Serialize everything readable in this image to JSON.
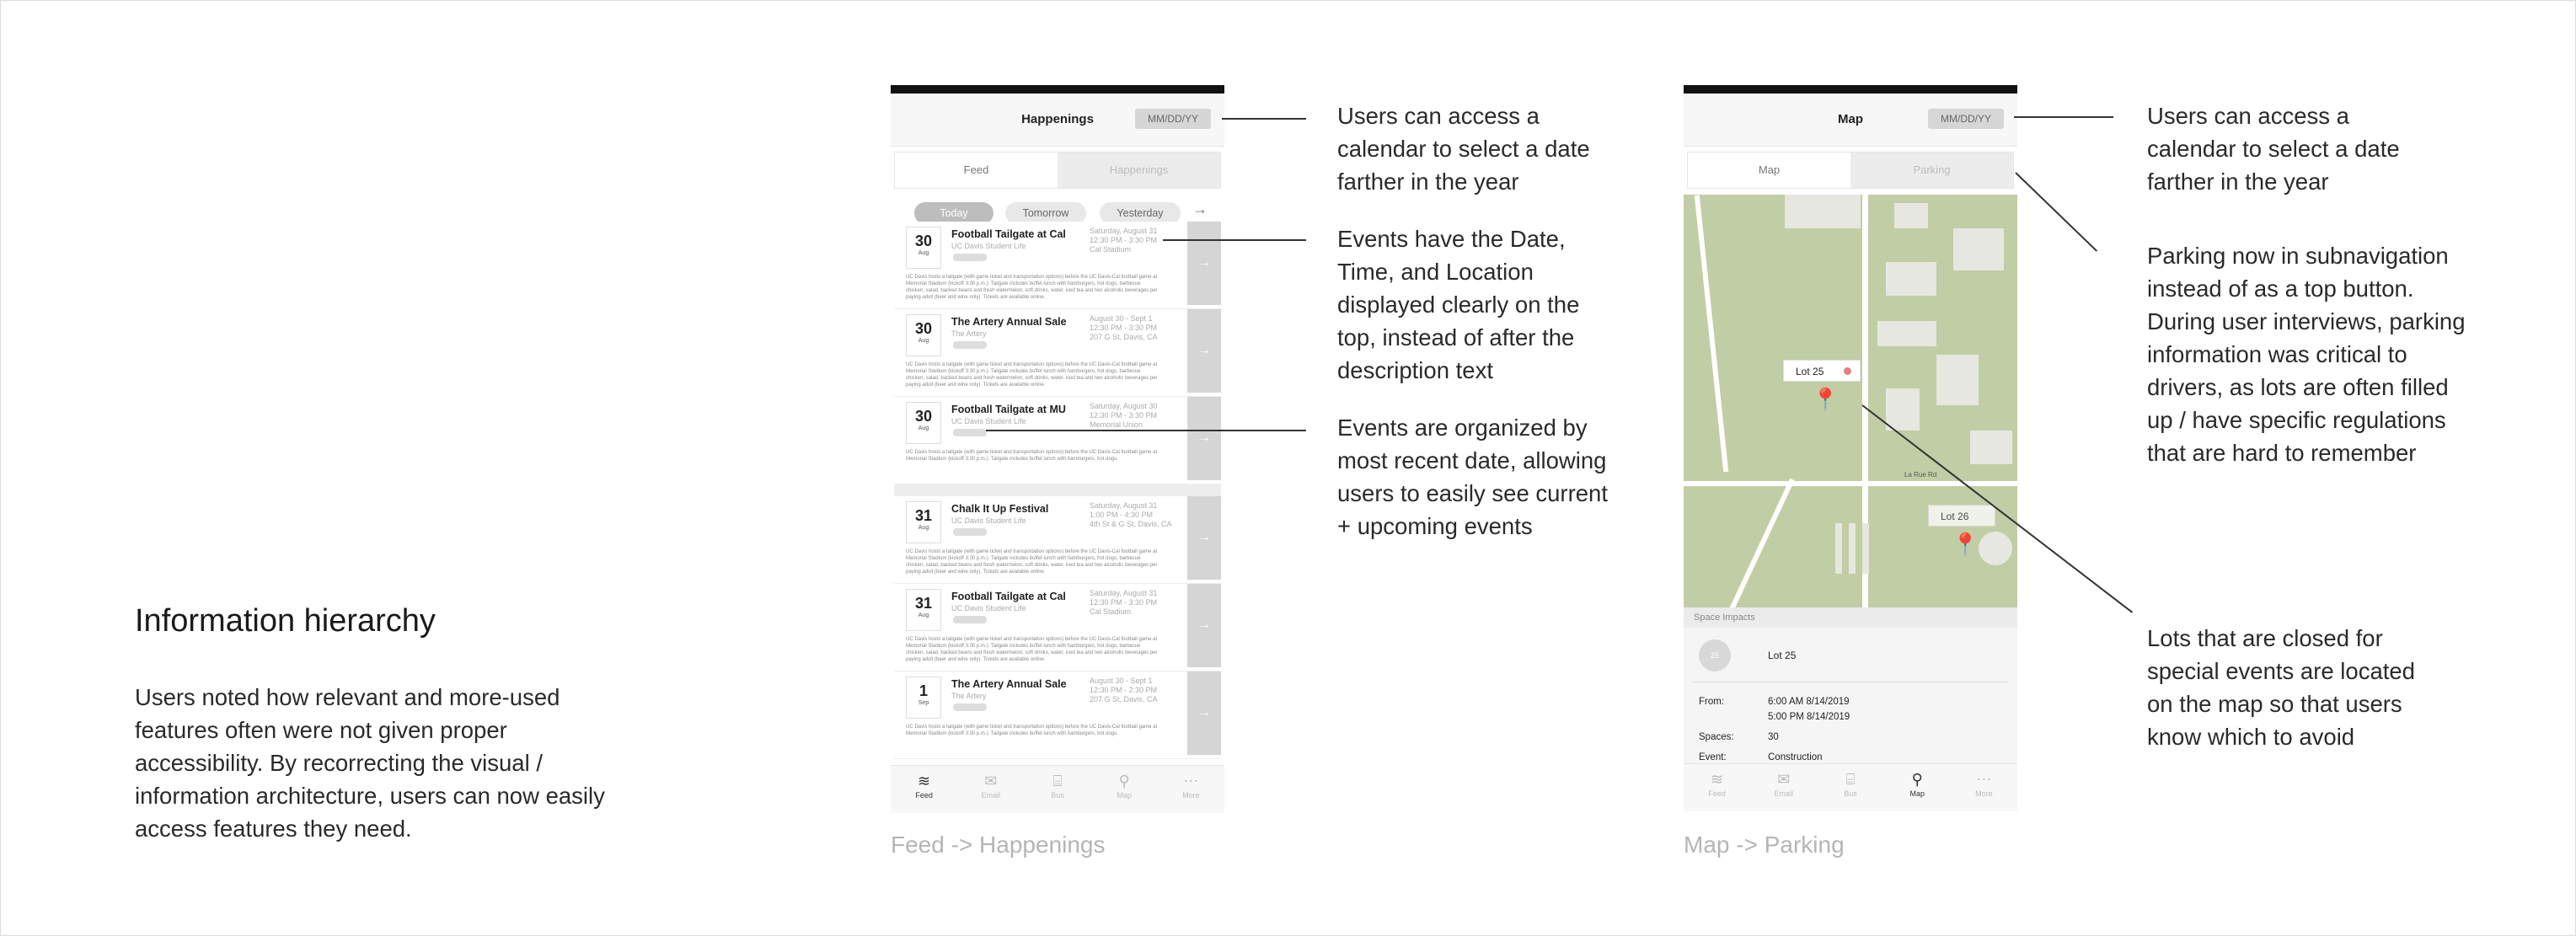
{
  "left": {
    "heading": "Information hierarchy",
    "description": "Users noted how relevant and more-used features often were not given proper accessibility.  By recorrecting the visual / information architecture, users can now easily access features they need."
  },
  "captions": {
    "happenings": "Feed -> Happenings",
    "parking": "Map -> Parking"
  },
  "annotations": {
    "calendar1": "Users can access a calendar to select a date farther in the year",
    "datetime": "Events have the Date, Time, and Location displayed clearly on the top, instead of after the description text",
    "organized": "Events are organized by most recent date, allowing users to easily see current + upcoming events",
    "calendar2": "Users can access a calendar to select a date farther in the year",
    "parking": "Parking now in subnavigation instead of as a top button. During user interviews, parking information was critical to drivers, as lots are often filled up / have specific regulations that are hard to remember",
    "lots": "Lots that are closed for special events are located on the map so that users know which to avoid"
  },
  "happenings_screen": {
    "title": "Happenings",
    "date_button": "MM/DD/YY",
    "seg": [
      "Feed",
      "Happenings"
    ],
    "filters": [
      "Today",
      "Tomorrow",
      "Yesterday"
    ],
    "arrow": "→",
    "events": [
      {
        "day": "30",
        "month": "Aug",
        "title": "Football Tailgate at Cal",
        "org": "UC Davis Student Life",
        "meta": "Saturday, August 31\n12:30 PM - 3:30 PM\nCal Stadium",
        "body": "UC Davis hosts a tailgate (with game ticket and transportation options) before the UC Davis-Cal football game at Memorial Stadium (kickoff 3:30 p.m.). Tailgate includes buffet lunch with hamburgers, hot dogs, barbecue chicken, salad, backed beans and fresh watermelon; soft drinks, water, iced tea and two alcoholic beverages per paying adult (beer and wine only). Tickets are available online."
      },
      {
        "day": "30",
        "month": "Aug",
        "title": "The Artery Annual Sale",
        "org": "The Artery",
        "meta": "August 30 - Sept 1\n12:30 PM - 3:30 PM\n207 G St, Davis, CA",
        "body": "UC Davis hosts a tailgate (with game ticket and transportation options) before the UC Davis-Cal football game at Memorial Stadium (kickoff 3:30 p.m.). Tailgate includes buffet lunch with hamburgers, hot dogs, barbecue chicken, salad, backed beans and fresh watermelon; soft drinks, water, iced tea and two alcoholic beverages per paying adult (beer and wine only). Tickets are available online."
      },
      {
        "day": "30",
        "month": "Aug",
        "title": "Football Tailgate at MU",
        "org": "UC Davis Student Life",
        "meta": "Saturday, August 30\n12:30 PM - 3:30 PM\nMemorial Union",
        "body": "UC Davis hosts a tailgate (with game ticket and transportation options) before the UC Davis-Cal football game at Memorial Stadium (kickoff 3:30 p.m.). Tailgate includes buffet lunch with hamburgers, hot dogs."
      },
      {
        "day": "31",
        "month": "Aug",
        "title": "Chalk It Up Festival",
        "org": "UC Davis Student Life",
        "meta": "Saturday, August 31\n1:00 PM - 4:30 PM\n4th St & G St, Davis, CA",
        "body": "UC Davis hosts a tailgate (with game ticket and transportation options) before the UC Davis-Cal football game at Memorial Stadium (kickoff 3:30 p.m.). Tailgate includes buffet lunch with hamburgers, hot dogs, barbecue chicken, salad, backed beans and fresh watermelon; soft drinks, water, iced tea and two alcoholic beverages per paying adult (beer and wine only). Tickets are available online."
      },
      {
        "day": "31",
        "month": "Aug",
        "title": "Football Tailgate at Cal",
        "org": "UC Davis Student Life",
        "meta": "Saturday, August 31\n12:30 PM - 3:30 PM\nCal Stadium",
        "body": "UC Davis hosts a tailgate (with game ticket and transportation options) before the UC Davis-Cal football game at Memorial Stadium (kickoff 3:30 p.m.). Tailgate includes buffet lunch with hamburgers, hot dogs, barbecue chicken, salad, backed beans and fresh watermelon; soft drinks, water, iced tea and two alcoholic beverages per paying adult (beer and wine only). Tickets are available online."
      },
      {
        "day": "1",
        "month": "Sep",
        "title": "The Artery Annual Sale",
        "org": "The Artery",
        "meta": "August 30 - Sept 1\n12:30 PM - 2:30 PM\n207 G St, Davis, CA",
        "body": "UC Davis hosts a tailgate (with game ticket and transportation options) before the UC Davis-Cal football game at Memorial Stadium (kickoff 3:30 p.m.). Tailgate includes buffet lunch with hamburgers, hot dogs."
      }
    ],
    "tabs": [
      "Feed",
      "Email",
      "Bus",
      "Map",
      "More"
    ]
  },
  "map_screen": {
    "title": "Map",
    "date_button": "MM/DD/YY",
    "seg": [
      "Map",
      "Parking"
    ],
    "lot_label": "Lot 25",
    "lot_label2": "Lot 26",
    "road_label": "La Rue Rd",
    "impacts_header": "Space Impacts",
    "circle_text": "25",
    "lot": "Lot 25",
    "from_label": "From:",
    "from_1": "6:00 AM  8/14/2019",
    "from_2": "5:00 PM  8/14/2019",
    "spaces_label": "Spaces:",
    "spaces": "30",
    "event_label": "Event:",
    "event": "Construction",
    "tabs": [
      "Feed",
      "Email",
      "Bus",
      "Map",
      "More"
    ]
  },
  "icons": [
    "feed-icon",
    "email-icon",
    "bus-icon",
    "map-icon",
    "more-icon",
    "map-pin-icon",
    "chevron-right-icon",
    "arrow-right-icon"
  ]
}
